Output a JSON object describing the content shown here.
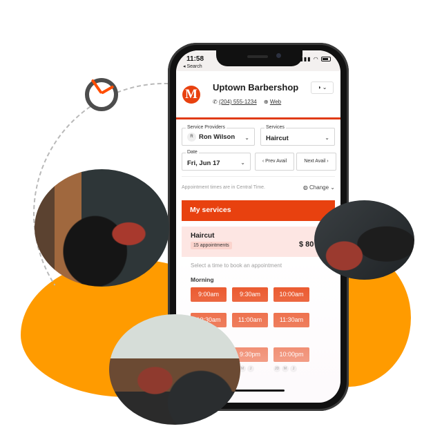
{
  "decor": {
    "accent_orange": "#ff9b00",
    "brand_red": "#e8410f",
    "photos": [
      {
        "alt": "Barber styling a client's hair in barbershop"
      },
      {
        "alt": "Barber cutting a client's hair"
      },
      {
        "alt": "Barber using clippers on client"
      }
    ]
  },
  "status_bar": {
    "time": "11:58",
    "back_label": "◂ Search",
    "icons": "▮▮▮ ◠"
  },
  "header": {
    "logo_letter": "M",
    "business_name": "Uptown Barbershop",
    "phone": "(204) 555-1234",
    "web_label": "Web",
    "theme_icon": "◑",
    "theme_chevron": "⌄"
  },
  "filters": {
    "provider": {
      "label": "Service Providers",
      "avatar_initial": "R",
      "value": "Ron Wilson"
    },
    "service": {
      "label": "Services",
      "value": "Haircut"
    },
    "date": {
      "label": "Date",
      "value": "Fri, Jun 17"
    },
    "prev_label": "‹  Prev Avail",
    "next_label": "Next Avail  ›"
  },
  "timezone": {
    "note": "Appointment times are in Central Time.",
    "change_label": "Change"
  },
  "services": {
    "section_title": "My services",
    "name": "Haircut",
    "count": "15 appointments",
    "price": "$ 80",
    "hint": "Select a time to book an appointment",
    "period": "Morning",
    "slots": [
      "9:00am",
      "9:30am",
      "10:00am",
      "10:30am",
      "11:00am",
      "11:30am",
      "9:30pm",
      "10:00pm"
    ],
    "slot_initials": [
      [
        "M",
        "J"
      ],
      [
        "JD",
        "M",
        "J"
      ]
    ]
  }
}
